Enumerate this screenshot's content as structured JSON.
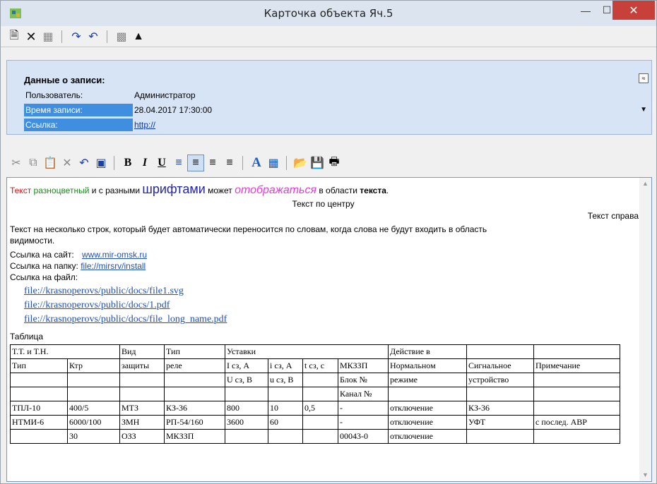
{
  "window": {
    "title": "Карточка объекта Яч.5"
  },
  "colors": {
    "title_bar": "#dbe4ef",
    "close_button": "#c7403a",
    "info_panel": "#d7e4f6",
    "selection": "#3f8ee0",
    "link": "#1f4fb8"
  },
  "toolbar": {
    "icons": [
      "new-icon",
      "delete-icon",
      "properties-icon",
      "redo-icon",
      "undo-icon",
      "cut-tool-icon",
      "stamp-icon"
    ]
  },
  "record": {
    "heading": "Данные о записи:",
    "rows": [
      {
        "label": "Пользователь:",
        "value": "Администратор"
      },
      {
        "label": "Время записи:",
        "value": "28.04.2017 17:30:00"
      },
      {
        "label": "Ссылка:",
        "value": "http://"
      }
    ],
    "collapse_glyph": "≈"
  },
  "editor_toolbar": {
    "bold": "B",
    "italic": "I",
    "underline": "U",
    "font_color": "A"
  },
  "content": {
    "line1": {
      "a": "Текст",
      "b": " разноцветный",
      "c": " и с разными ",
      "d": "шрифтами",
      "e": " может ",
      "f": "отображаться",
      "g": " в области ",
      "h": "текста",
      "i": "."
    },
    "center": "Текст по центру",
    "right": "Текст справа",
    "wrap1": "Текст на несколько строк, который будет автоматически переносится по словам, когда слова не будут входить в область",
    "wrap2": "видимости.",
    "site_label": "Ссылка на сайт:",
    "site_url": "www.mir-omsk.ru",
    "folder_label": "Ссылка на папку:",
    "folder_url": "file://mirsrv/install",
    "file_label": "Ссылка на файл:",
    "files": [
      "file://krasnoperovs/public/docs/file1.svg",
      "file://krasnoperovs/public/docs/1.pdf",
      "file://krasnoperovs/public/docs/file_long_name.pdf"
    ],
    "table_caption": "Таблица"
  },
  "table": {
    "header": [
      [
        "Т.Т. и Т.Н.",
        "",
        "Вид",
        "Тип",
        "Уставки",
        "",
        "",
        "",
        "Действие в",
        "",
        ""
      ],
      [
        "Тип",
        "Ктр",
        "защиты",
        "реле",
        "I сз, А",
        "i сз, А",
        "t сз, с",
        "МКЗЗП",
        "Нормальном",
        "Сигнальное",
        "Примечание"
      ],
      [
        "",
        "",
        "",
        "",
        "U сз, В",
        "u сз, В",
        "",
        "Блок №",
        "режиме",
        "устройство",
        ""
      ],
      [
        "",
        "",
        "",
        "",
        "",
        "",
        "",
        "Канал №",
        "",
        "",
        ""
      ]
    ],
    "rows": [
      [
        "ТПЛ-10",
        "400/5",
        "МТЗ",
        "КЗ-36",
        "800",
        "10",
        "0,5",
        "-",
        "отключение",
        "КЗ-36",
        ""
      ],
      [
        "НТМИ-6",
        "6000/100",
        "ЗМН",
        "РП-54/160",
        "3600",
        "60",
        "",
        "-",
        "отключение",
        "УФТ",
        "с послед. АВР"
      ],
      [
        "",
        "30",
        "ОЗЗ",
        "МКЗЗП",
        "",
        "",
        "",
        "00043-0",
        "отключение",
        "",
        ""
      ]
    ]
  }
}
